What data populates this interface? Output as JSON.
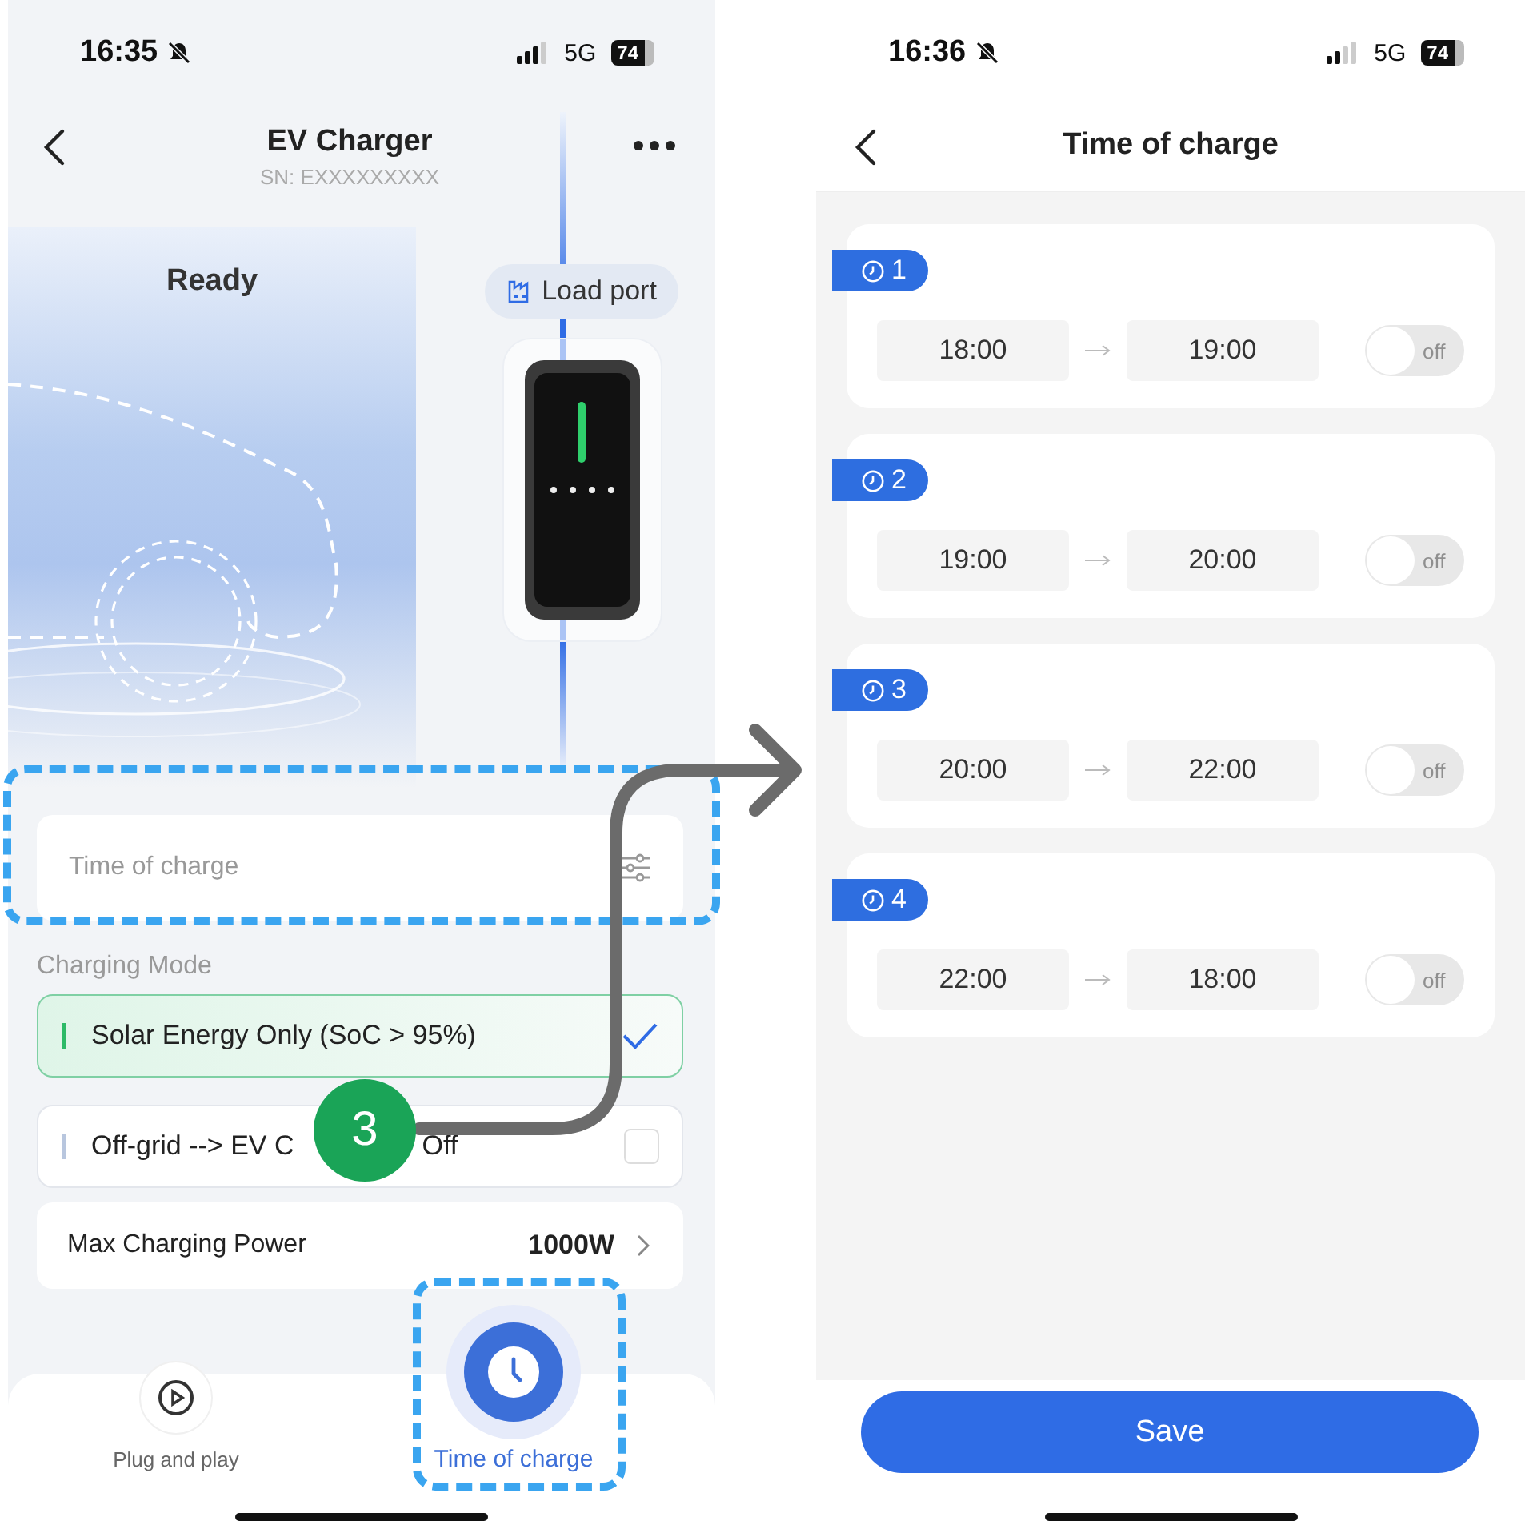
{
  "left_screen": {
    "status_bar": {
      "time": "16:35",
      "network": "5G",
      "battery": "74"
    },
    "header": {
      "title": "EV Charger",
      "serial": "SN: EXXXXXXXXX"
    },
    "status": "Ready",
    "load_port": "Load port",
    "time_of_charge_card": {
      "label": "Time of charge"
    },
    "charging_mode": {
      "title": "Charging Mode",
      "options": [
        {
          "label_start": "Solar Energy Only (SoC > 95%)",
          "selected": true
        },
        {
          "label_start": "Off-grid --> EV C",
          "label_end": "Off",
          "selected": false
        }
      ]
    },
    "max_power": {
      "label": "Max Charging Power",
      "value": "1000W"
    },
    "tab_bar": [
      {
        "label": "Plug and play",
        "kind": "play",
        "selected": false
      },
      {
        "label": "Time of charge",
        "kind": "clock",
        "selected": true
      }
    ]
  },
  "right_screen": {
    "status_bar": {
      "time": "16:36",
      "network": "5G",
      "battery": "74"
    },
    "header": {
      "title": "Time of charge"
    },
    "slots": [
      {
        "number": "1",
        "start": "18:00",
        "end": "19:00",
        "toggle_label": "off",
        "on": false
      },
      {
        "number": "2",
        "start": "19:00",
        "end": "20:00",
        "toggle_label": "off",
        "on": false
      },
      {
        "number": "3",
        "start": "20:00",
        "end": "22:00",
        "toggle_label": "off",
        "on": false
      },
      {
        "number": "4",
        "start": "22:00",
        "end": "18:00",
        "toggle_label": "off",
        "on": false
      }
    ],
    "save_button": "Save"
  },
  "annotation": {
    "step": "3"
  }
}
